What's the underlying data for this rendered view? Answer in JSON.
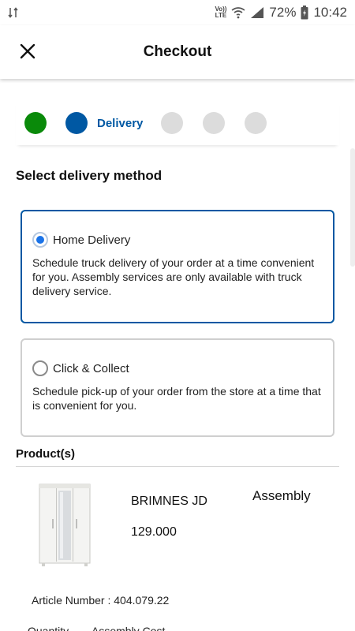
{
  "status_bar": {
    "network_label_top": "Vo))",
    "network_label_bottom": "LTE",
    "battery_percent": "72%",
    "time": "10:42"
  },
  "header": {
    "title": "Checkout"
  },
  "stepper": {
    "current_step_label": "Delivery",
    "step_colors": {
      "completed": "#0a8a0a",
      "current": "#0058a3",
      "pending": "#dcdcdc"
    }
  },
  "delivery": {
    "section_title": "Select delivery method",
    "options": [
      {
        "label": "Home Delivery",
        "description": "Schedule truck delivery of your order at a time convenient for you. Assembly services are only available with truck delivery service.",
        "selected": true
      },
      {
        "label": "Click & Collect",
        "description": "Schedule pick-up of your order from the store at a time that is convenient for you.",
        "selected": false
      }
    ]
  },
  "products": {
    "section_title": "Product(s)",
    "items": [
      {
        "name": "BRIMNES JD",
        "price": "129.000",
        "assembly_label": "Assembly",
        "article_number": "Article Number : 404.079.22",
        "quantity_label": "Quantity",
        "assembly_cost_label": "Assembly Cost"
      }
    ]
  },
  "colors": {
    "accent": "#0058a3",
    "radio_selected": "#1a73e8"
  }
}
